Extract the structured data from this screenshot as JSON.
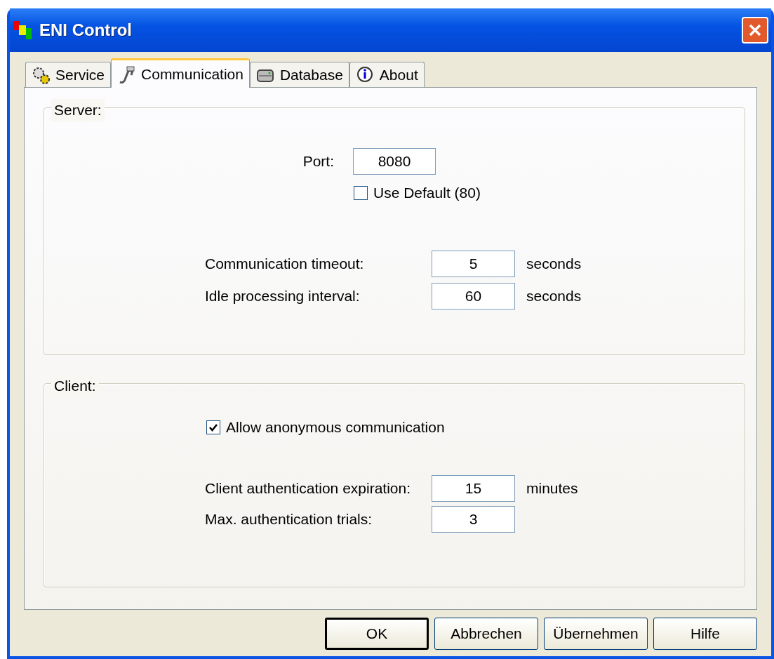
{
  "window": {
    "title": "ENI Control"
  },
  "tabs": [
    {
      "label": "Service",
      "selected": false
    },
    {
      "label": "Communication",
      "selected": true
    },
    {
      "label": "Database",
      "selected": false
    },
    {
      "label": "About",
      "selected": false
    }
  ],
  "server": {
    "legend": "Server:",
    "port": {
      "label": "Port:",
      "value": "8080"
    },
    "use_default": {
      "label": "Use Default (80)",
      "checked": false
    },
    "fields": [
      {
        "label": "Communication timeout:",
        "value": "5",
        "unit": "seconds"
      },
      {
        "label": "Idle processing interval:",
        "value": "60",
        "unit": "seconds"
      }
    ]
  },
  "client": {
    "legend": "Client:",
    "allow_anonymous": {
      "label": "Allow anonymous communication",
      "checked": true
    },
    "fields": [
      {
        "label": "Client authentication expiration:",
        "value": "15",
        "unit": "minutes"
      },
      {
        "label": "Max. authentication trials:",
        "value": "3"
      }
    ]
  },
  "buttons": [
    {
      "label": "OK",
      "default": true
    },
    {
      "label": "Abbrechen",
      "default": false
    },
    {
      "label": "Übernehmen",
      "default": false
    },
    {
      "label": "Hilfe",
      "default": false
    }
  ]
}
